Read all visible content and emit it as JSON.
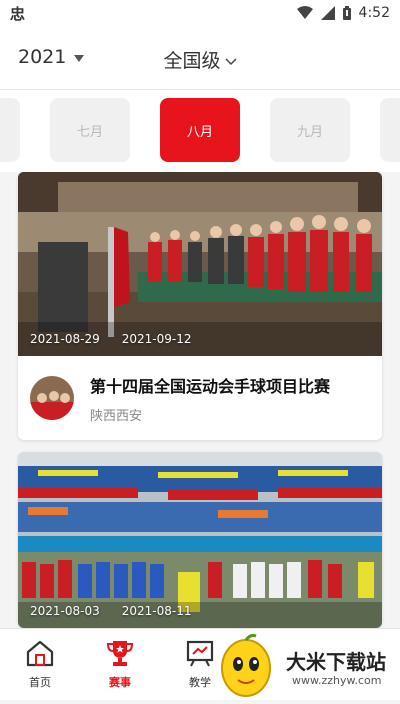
{
  "status_bar": {
    "left_glyph": "忠",
    "time": "4:52",
    "icons": [
      "wifi-icon",
      "signal-icon",
      "battery-icon"
    ]
  },
  "header": {
    "year": "2021",
    "level": "全国级"
  },
  "months": [
    {
      "label": "七月",
      "active": false
    },
    {
      "label": "八月",
      "active": true
    },
    {
      "label": "九月",
      "active": false
    }
  ],
  "cards": [
    {
      "date_start": "2021-08-29",
      "date_end": "2021-09-12",
      "title": "第十四届全国运动会手球项目比赛",
      "location": "陕西西安"
    },
    {
      "date_start": "2021-08-03",
      "date_end": "2021-08-11"
    }
  ],
  "tabs": [
    {
      "label": "首页",
      "icon": "home-icon",
      "active": false
    },
    {
      "label": "赛事",
      "icon": "trophy-icon",
      "active": true
    },
    {
      "label": "教学",
      "icon": "teaching-icon",
      "active": false
    }
  ],
  "ad": {
    "main_text": "大米下载站",
    "sub_text": "www.zzhyw.com"
  },
  "colors": {
    "accent": "#e8141c",
    "text": "#333333",
    "muted": "#888888"
  }
}
